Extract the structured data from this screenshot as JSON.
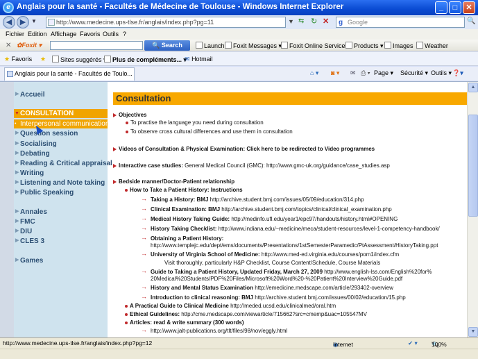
{
  "window": {
    "title": "Anglais pour la santé - Facultés de Médecine de Toulouse - Windows Internet Explorer"
  },
  "address_bar": {
    "url": "http://www.medecine.ups-tlse.fr/anglais/index.php?pg=11",
    "search_placeholder": "Google"
  },
  "menu": [
    "Fichier",
    "Edition",
    "Affichage",
    "Favoris",
    "Outils",
    "?"
  ],
  "foxit_toolbar": {
    "brand": "Foxit",
    "search": "Search",
    "items": [
      "Launch",
      "Foxit Messages",
      "Foxit Online Services",
      "Products",
      "Images",
      "Weather"
    ]
  },
  "favorites_bar": {
    "favorites": "Favoris",
    "suggested": "Sites suggérés",
    "more": "Plus de compléments...",
    "hotmail": "Hotmail"
  },
  "tab": {
    "title": "Anglais pour la santé - Facultés de Toulo..."
  },
  "command_bar": [
    "Page",
    "Sécurité",
    "Outils"
  ],
  "sidebar": {
    "items": [
      {
        "label": "Accueil"
      },
      {
        "label": "CONSULTATION"
      },
      {
        "label": "Interpersonal communication"
      },
      {
        "label": "Question session"
      },
      {
        "label": "Socialising"
      },
      {
        "label": "Debating"
      },
      {
        "label": "Reading & Critical appraisal"
      },
      {
        "label": "Writing"
      },
      {
        "label": "Listening and Note taking"
      },
      {
        "label": "Public Speaking"
      },
      {
        "label": "Annales"
      },
      {
        "label": "FMC"
      },
      {
        "label": "DIU"
      },
      {
        "label": "CLES 3"
      },
      {
        "label": "Games"
      }
    ]
  },
  "content": {
    "heading": "Consultation",
    "objectives_label": "Objectives",
    "objectives": [
      "To practise the language you need during consultation",
      "To observe cross cultural differences and use them in consultation"
    ],
    "videos": "Videos of Consultation & Physical Examination: Click here to be redirected to Video programmes",
    "cases_label": "Interactive case studies:",
    "cases_text": " General Medical Council (GMC): http://www.gmc-uk.org/guidance/case_studies.asp",
    "bedside": "Bedside manner/Doctor-Patient relationship",
    "history_title": "How to Take a Patient History: Instructions",
    "links": [
      {
        "label": "Taking a History: BMJ",
        "url": " http://archive.student.bmj.com/issues/05/09/education/314.php"
      },
      {
        "label": "Clinical Examination: BMJ",
        "url": " http://archive.student.bmj.com/topics/clinical/clinical_examination.php"
      },
      {
        "label": "Medical History Taking Guide:",
        "url": " http://medinfo.ufl.edu/year1/epc97/handouts/history.html#OPENING"
      },
      {
        "label": "History Taking Checklist:",
        "url": " http://www.indiana.edu/~medicine/meca/student-resources/level-1-competency-handbook/"
      },
      {
        "label": "Obtaining a Patient History:",
        "url": ""
      },
      {
        "label": "University of Virginia School of Medicine:",
        "url": " http://www.med-ed.virginia.edu/courses/pom1/index.cfm"
      },
      {
        "label": "Guide to Taking a Patient History, Updated Friday, March 27, 2009",
        "url": " http://www.english-lss.com/English%20for%"
      },
      {
        "label": "History and Mental Status Examination",
        "url": " http://emedicine.medscape.com/article/293402-overview"
      },
      {
        "label": "Introduction to clinical reasoning: BMJ",
        "url": " http://archive.student.bmj.com/issues/00/02/education/15.php"
      }
    ],
    "obtaining_url": "http://www.templejc.edu/dept/ems/documents/Presentations/1stSemesterParamedic/PtAssessment/HistoryTaking.ppt",
    "virginia_note": "Visit thoroughly, particularly H&P Checklist, Course Content/Schedule, Course Materials",
    "guide_cont": "20Medical%20Students/PDF%20Files/Microsoft%20Word%20-%20Patient%20Interview%20Guide.pdf",
    "practical_label": "A Practical Guide to Clinical Medicine",
    "practical_url": " http://meded.ucsd.edu/clinicalmed/oral.htm",
    "ethical_label": "Ethical Guidelines:",
    "ethical_url": " http://cme.medscape.com/viewarticle/715662?src=cmemp&uac=105547MV",
    "articles_label": "Articles: read & write summary (300 words)",
    "articles_url": "http://www.jalt-publications.org/tlt/files/98/nov/eggly.html"
  },
  "status_bar": {
    "url": "http://www.medecine.ups-tlse.fr/anglais/index.php?pg=12",
    "zone": "Internet",
    "zoom": "100%"
  }
}
